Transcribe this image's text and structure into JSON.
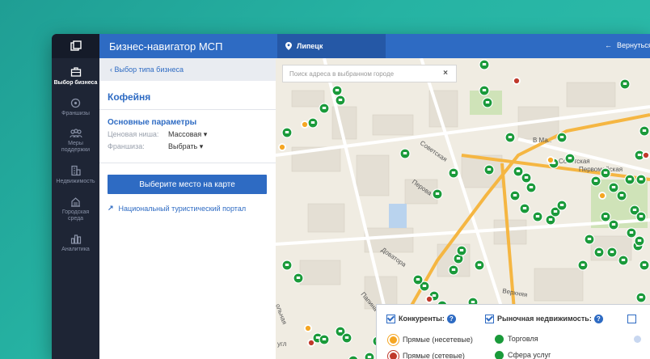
{
  "rail": {
    "items": [
      {
        "label": "Выбор бизнеса",
        "icon": "business-select-icon",
        "active": true
      },
      {
        "label": "Франшизы",
        "icon": "franchise-icon"
      },
      {
        "label": "Меры поддержки",
        "icon": "support-icon"
      },
      {
        "label": "Недвижимость",
        "icon": "real-estate-icon"
      },
      {
        "label": "Городская среда",
        "icon": "city-environment-icon"
      },
      {
        "label": "Аналитика",
        "icon": "analytics-icon"
      }
    ]
  },
  "header": {
    "app_title": "Бизнес-навигатор МСП",
    "city": "Липецк",
    "back_label": "Вернуться на портал"
  },
  "panel": {
    "breadcrumb": "Выбор типа бизнеса",
    "title": "Кофейня",
    "section_title": "Основные параметры",
    "params": [
      {
        "key": "Ценовая ниша:",
        "value": "Массовая"
      },
      {
        "key": "Франшиза:",
        "value": "Выбрать"
      }
    ],
    "action_button": "Выберите место на карте",
    "portal_link": "Национальный туристический портал"
  },
  "map": {
    "search_placeholder": "Поиск адреса в выбранном городе",
    "street_labels": [
      "Советская",
      "Перова",
      "Доватора",
      "Папина",
      "Верхняя",
      "В Ма..",
      "Советская",
      "Первомайская",
      "ольная",
      "угл"
    ],
    "legend": {
      "competitors_label": "Конкуренты:",
      "realestate_label": "Рыночная недвижимость:",
      "items_left": [
        "Прямые (несетевые)",
        "Прямые (сетевые)"
      ],
      "items_right": [
        "Торговля",
        "Сфера услуг"
      ]
    }
  },
  "colors": {
    "accent": "#2e6bc3",
    "rail": "#1e2535",
    "marker_green": "#1a9a3a",
    "marker_orange": "#f5a623",
    "marker_red": "#c0392b"
  }
}
